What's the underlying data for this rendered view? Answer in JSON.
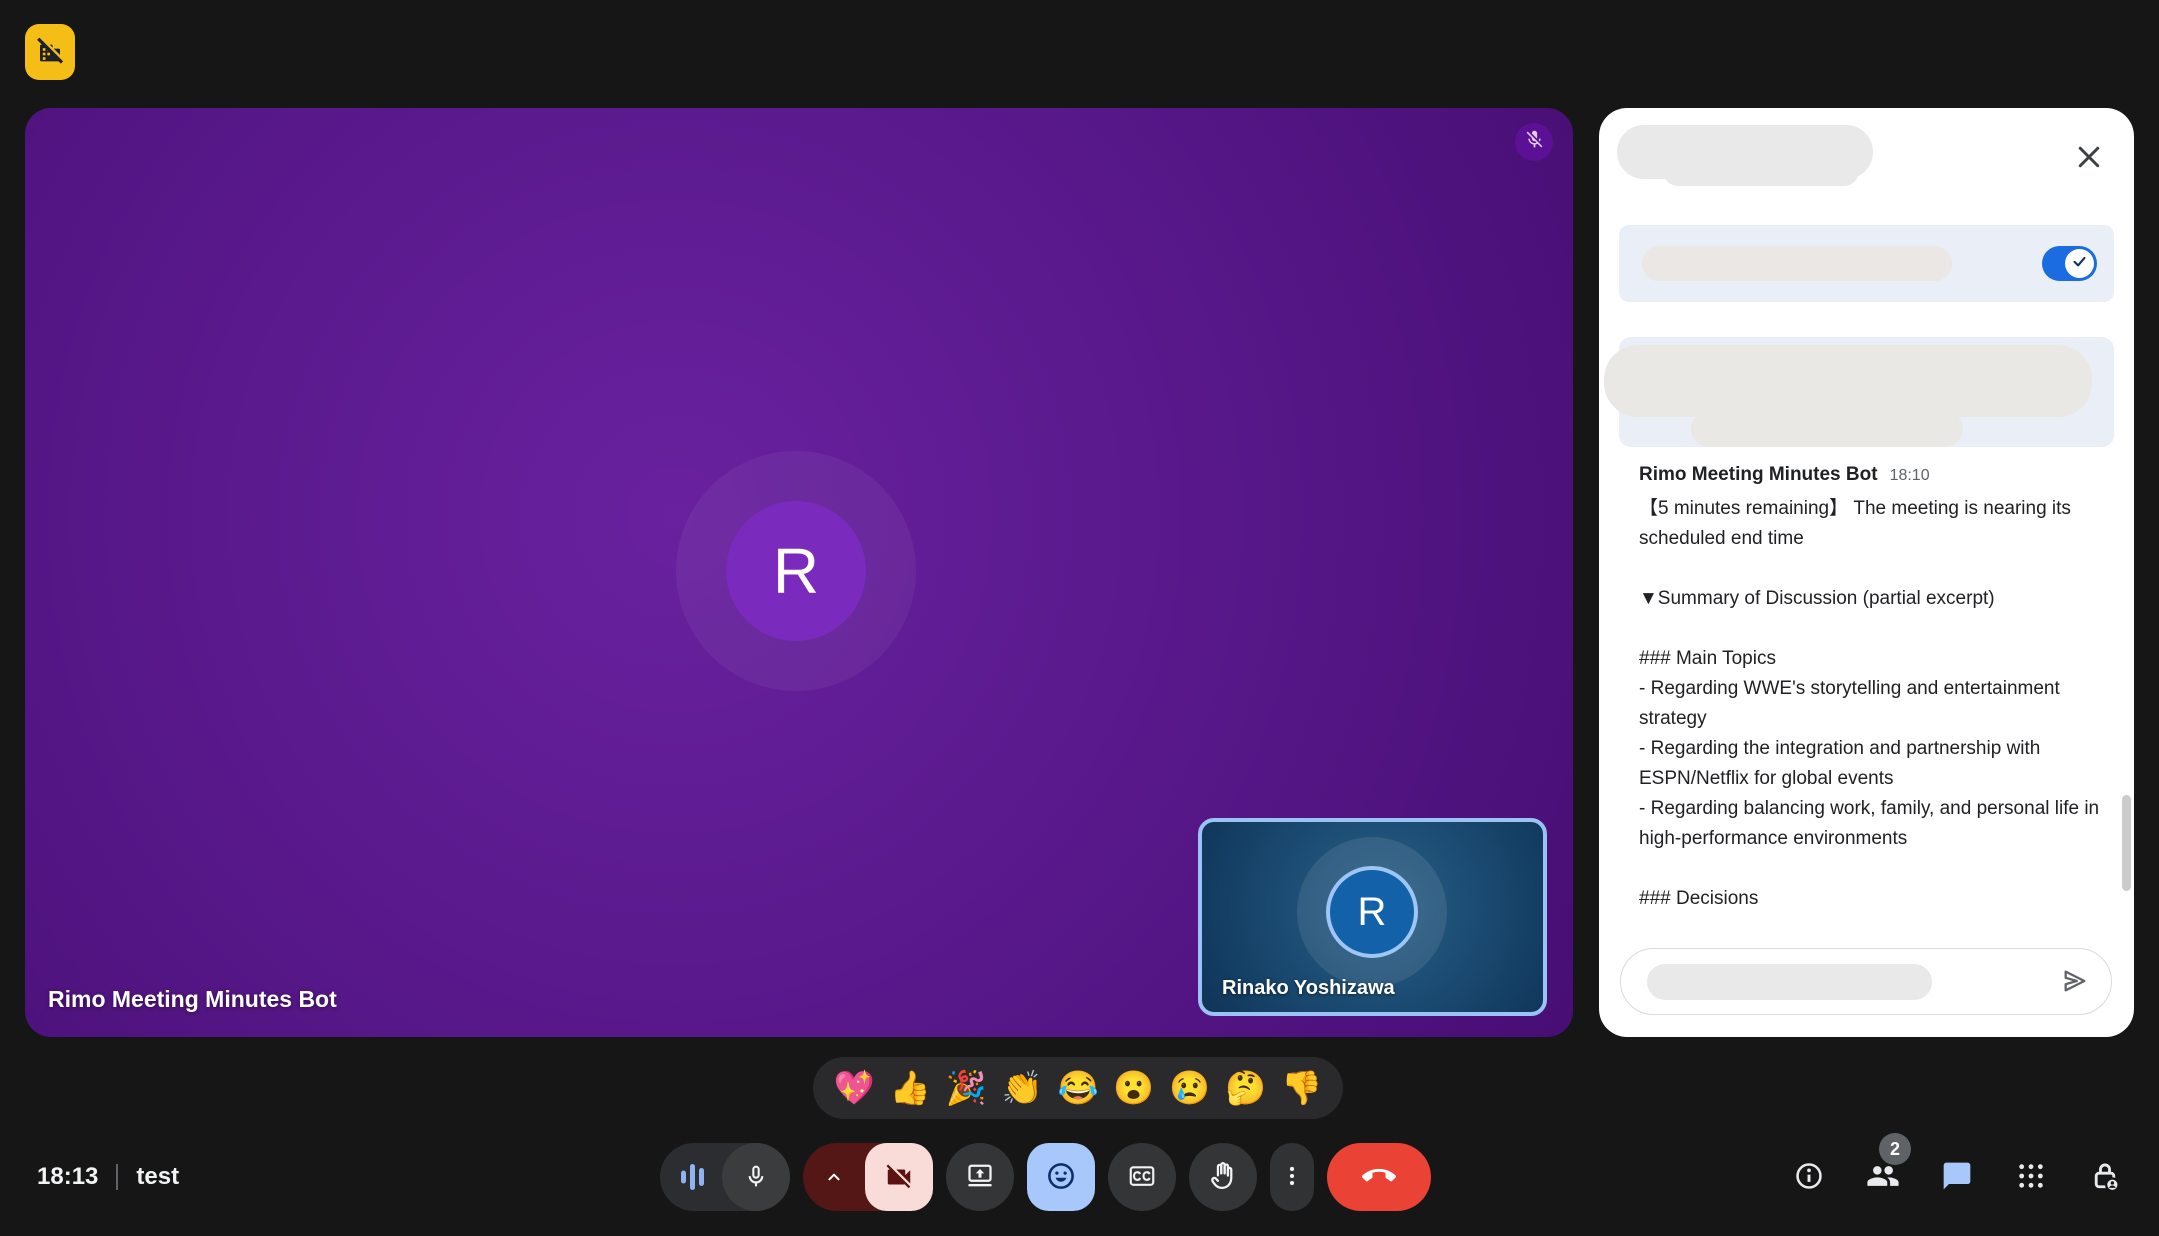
{
  "main_tile": {
    "name": "Rimo Meeting Minutes Bot",
    "avatar_letter": "R",
    "mic_muted": true
  },
  "pip_tile": {
    "name": "Rinako Yoshizawa",
    "avatar_letter": "R",
    "speaking_border": "#9ac2f4"
  },
  "chat_panel": {
    "toggle_on": true,
    "message": {
      "sender": "Rimo Meeting Minutes Bot",
      "time": "18:10",
      "body": "【5 minutes remaining】 The meeting is nearing its scheduled end time\n\n▼Summary of Discussion (partial excerpt)\n\n### Main Topics\n- Regarding WWE's storytelling and entertainment strategy\n- Regarding the integration and partnership with ESPN/Netflix for global events\n- Regarding balancing work, family, and personal life in high-performance environments\n\n### Decisions"
    }
  },
  "reactions": {
    "emojis": [
      "💖",
      "👍",
      "🎉",
      "👏",
      "😂",
      "😮",
      "😢",
      "🤔",
      "👎"
    ]
  },
  "status_bar": {
    "clock": "18:13",
    "meeting_name": "test",
    "participants_count": "2"
  },
  "colors": {
    "accent_blue": "#1a6ce0",
    "chat_active_blue": "#a8c7fa",
    "end_call_red": "#ea4335",
    "camera_off_pink": "#f9dcd8",
    "camera_off_maroon": "#541716",
    "brand_badge_yellow": "#f5be16"
  }
}
